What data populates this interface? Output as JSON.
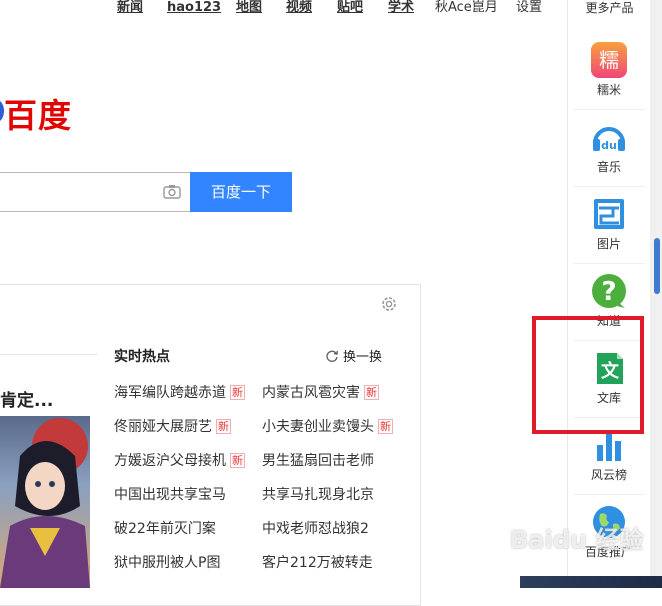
{
  "nav": {
    "links": [
      "新闻",
      "hao123",
      "地图",
      "视频",
      "贴吧",
      "学术"
    ],
    "user": "秋Ace崑月",
    "settings": "设置"
  },
  "logo": {
    "text": "百度"
  },
  "search": {
    "value": "",
    "button_label": "百度一下"
  },
  "feed": {
    "headline": "肯定...",
    "hot_title": "实时热点",
    "refresh_label": "换一换",
    "new_badge": "新",
    "hot_list": [
      {
        "text": "海军编队跨越赤道",
        "is_new": true
      },
      {
        "text": "内蒙古风雹灾害",
        "is_new": true
      },
      {
        "text": "佟丽娅大展厨艺",
        "is_new": true
      },
      {
        "text": "小夫妻创业卖馒头",
        "is_new": true
      },
      {
        "text": "方媛返沪父母接机",
        "is_new": true
      },
      {
        "text": "男生猛扇回击老师",
        "is_new": false
      },
      {
        "text": "中国出现共享宝马",
        "is_new": false
      },
      {
        "text": "共享马扎现身北京",
        "is_new": false
      },
      {
        "text": "破22年前灭门案",
        "is_new": false
      },
      {
        "text": "中戏老师怼战狼2",
        "is_new": false
      },
      {
        "text": "狱中服刑被人P图",
        "is_new": false
      },
      {
        "text": "客户212万被转走",
        "is_new": false
      }
    ]
  },
  "sidebar": {
    "header": "更多产品",
    "items": [
      {
        "label": "糯米",
        "icon": "nuomi-icon",
        "color": "#f35a6e"
      },
      {
        "label": "音乐",
        "icon": "music-du-icon",
        "color": "#2f8fe0"
      },
      {
        "label": "图片",
        "icon": "image-icon",
        "color": "#2f8fe0"
      },
      {
        "label": "知道",
        "icon": "zhidao-question-icon",
        "color": "#4cae3c"
      },
      {
        "label": "文库",
        "icon": "wenku-doc-icon",
        "color": "#22a35a"
      },
      {
        "label": "风云榜",
        "icon": "bar-chart-icon",
        "color": "#2f8fe0"
      },
      {
        "label": "百度推广",
        "icon": "globe-icon",
        "color": "#2f8fe0"
      }
    ]
  },
  "watermark": "Baidu 经验",
  "colors": {
    "brand_red": "#e10602",
    "brand_blue": "#3385ff",
    "highlight": "#e0192b"
  }
}
